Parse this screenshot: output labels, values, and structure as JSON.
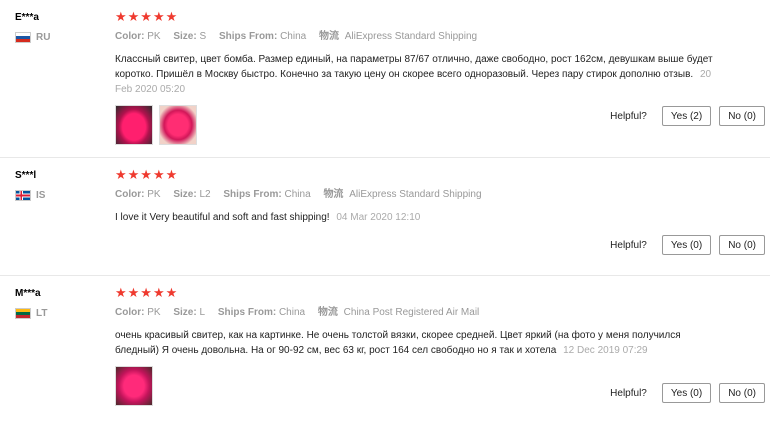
{
  "labels": {
    "color": "Color:",
    "size": "Size:",
    "ships_from": "Ships From:",
    "logistics_icon": "物流",
    "helpful": "Helpful?"
  },
  "reviews": [
    {
      "user": "E***a",
      "country": "RU",
      "stars": "★★★★★",
      "color": "PK",
      "size": "S",
      "ships_from": "China",
      "logistics": "AliExpress Standard Shipping",
      "text": "Классный свитер, цвет бомба. Размер единый, на параметры 87/67 отлично, даже свободно, рост 162см, девушкам выше будет коротко. Пришёл в Москву быстро. Конечно за такую цену он скорее всего одноразовый. Через пару стирок дополню отзыв.",
      "date": "20 Feb 2020 05:20",
      "yes": "Yes (2)",
      "no": "No (0)"
    },
    {
      "user": "S***l",
      "country": "IS",
      "stars": "★★★★★",
      "color": "PK",
      "size": "L2",
      "ships_from": "China",
      "logistics": "AliExpress Standard Shipping",
      "text": "I love it Very beautiful and soft and fast shipping!",
      "date": "04 Mar 2020 12:10",
      "yes": "Yes (0)",
      "no": "No (0)"
    },
    {
      "user": "M***a",
      "country": "LT",
      "stars": "★★★★★",
      "color": "PK",
      "size": "L",
      "ships_from": "China",
      "logistics": "China Post Registered Air Mail",
      "text": "очень красивый свитер, как на картинке. Не очень толстой вязки, скорее средней. Цвет яркий (на фото у меня получился бледный) Я очень довольна. На ог 90-92 см, вес 63 кг, рост 164 сел свободно но я так и хотела",
      "date": "12 Dec 2019 07:29",
      "yes": "Yes (0)",
      "no": "No (0)"
    }
  ]
}
